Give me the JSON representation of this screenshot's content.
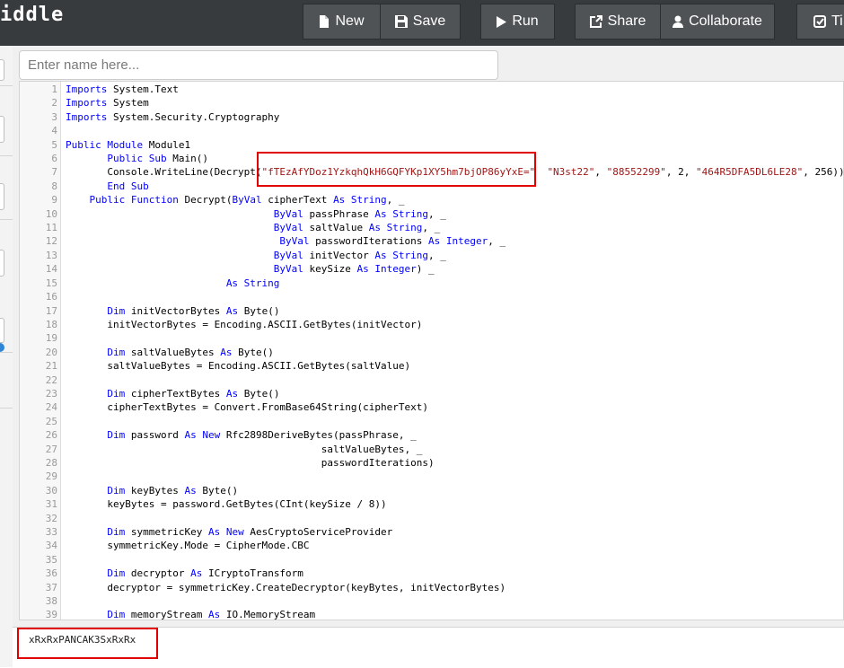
{
  "app": {
    "logo_text": "iddle"
  },
  "toolbar": [
    {
      "id": "new",
      "label": "New",
      "icon": "file-icon"
    },
    {
      "id": "save",
      "label": "Save",
      "icon": "floppy-icon"
    },
    {
      "id": "run",
      "label": "Run",
      "icon": "play-icon"
    },
    {
      "id": "share",
      "label": "Share",
      "icon": "share-icon"
    },
    {
      "id": "collaborate",
      "label": "Collaborate",
      "icon": "user-icon"
    },
    {
      "id": "tidy",
      "label": "Ti",
      "icon": "checkbox-icon"
    }
  ],
  "name_field": {
    "placeholder": "Enter name here...",
    "value": ""
  },
  "editor": {
    "lines": [
      [
        [
          "kw",
          "Imports"
        ],
        [
          "t",
          " System.Text"
        ]
      ],
      [
        [
          "kw",
          "Imports"
        ],
        [
          "t",
          " System"
        ]
      ],
      [
        [
          "kw",
          "Imports"
        ],
        [
          "t",
          " System.Security.Cryptography"
        ]
      ],
      [],
      [
        [
          "kw",
          "Public Module"
        ],
        [
          "t",
          " Module1"
        ]
      ],
      [
        [
          "t",
          "       "
        ],
        [
          "kw",
          "Public Sub"
        ],
        [
          "t",
          " Main()"
        ]
      ],
      [
        [
          "t",
          "       Console.WriteLine(Decrypt("
        ],
        [
          "st",
          "\"fTEzAfYDoz1YzkqhQkH6GQFYKp1XY5hm7bjOP86yYxE=\""
        ],
        [
          "t",
          "  "
        ],
        [
          "st",
          "\"N3st22\""
        ],
        [
          "t",
          ", "
        ],
        [
          "st",
          "\"88552299\""
        ],
        [
          "t",
          ", 2, "
        ],
        [
          "st",
          "\"464R5DFA5DL6LE28\""
        ],
        [
          "t",
          ", 256))"
        ]
      ],
      [
        [
          "t",
          "       "
        ],
        [
          "kw",
          "End Sub"
        ]
      ],
      [
        [
          "t",
          "    "
        ],
        [
          "kw",
          "Public Function"
        ],
        [
          "t",
          " Decrypt("
        ],
        [
          "kw",
          "ByVal"
        ],
        [
          "t",
          " cipherText "
        ],
        [
          "kw",
          "As String"
        ],
        [
          "t",
          ", _"
        ]
      ],
      [
        [
          "t",
          "                                   "
        ],
        [
          "kw",
          "ByVal"
        ],
        [
          "t",
          " passPhrase "
        ],
        [
          "kw",
          "As String"
        ],
        [
          "t",
          ", _"
        ]
      ],
      [
        [
          "t",
          "                                   "
        ],
        [
          "kw",
          "ByVal"
        ],
        [
          "t",
          " saltValue "
        ],
        [
          "kw",
          "As String"
        ],
        [
          "t",
          ", _"
        ]
      ],
      [
        [
          "t",
          "                                    "
        ],
        [
          "kw",
          "ByVal"
        ],
        [
          "t",
          " passwordIterations "
        ],
        [
          "kw",
          "As Integer"
        ],
        [
          "t",
          ", _"
        ]
      ],
      [
        [
          "t",
          "                                   "
        ],
        [
          "kw",
          "ByVal"
        ],
        [
          "t",
          " initVector "
        ],
        [
          "kw",
          "As String"
        ],
        [
          "t",
          ", _"
        ]
      ],
      [
        [
          "t",
          "                                   "
        ],
        [
          "kw",
          "ByVal"
        ],
        [
          "t",
          " keySize "
        ],
        [
          "kw",
          "As Integer"
        ],
        [
          "t",
          ") _"
        ]
      ],
      [
        [
          "t",
          "                           "
        ],
        [
          "kw",
          "As String"
        ]
      ],
      [],
      [
        [
          "t",
          "       "
        ],
        [
          "kw",
          "Dim"
        ],
        [
          "t",
          " initVectorBytes "
        ],
        [
          "kw",
          "As"
        ],
        [
          "t",
          " Byte()"
        ]
      ],
      [
        [
          "t",
          "       initVectorBytes = Encoding.ASCII.GetBytes(initVector)"
        ]
      ],
      [],
      [
        [
          "t",
          "       "
        ],
        [
          "kw",
          "Dim"
        ],
        [
          "t",
          " saltValueBytes "
        ],
        [
          "kw",
          "As"
        ],
        [
          "t",
          " Byte()"
        ]
      ],
      [
        [
          "t",
          "       saltValueBytes = Encoding.ASCII.GetBytes(saltValue)"
        ]
      ],
      [],
      [
        [
          "t",
          "       "
        ],
        [
          "kw",
          "Dim"
        ],
        [
          "t",
          " cipherTextBytes "
        ],
        [
          "kw",
          "As"
        ],
        [
          "t",
          " Byte()"
        ]
      ],
      [
        [
          "t",
          "       cipherTextBytes = Convert.FromBase64String(cipherText)"
        ]
      ],
      [],
      [
        [
          "t",
          "       "
        ],
        [
          "kw",
          "Dim"
        ],
        [
          "t",
          " password "
        ],
        [
          "kw",
          "As New"
        ],
        [
          "t",
          " Rfc2898DeriveBytes(passPhrase, _"
        ]
      ],
      [
        [
          "t",
          "                                           saltValueBytes, _"
        ]
      ],
      [
        [
          "t",
          "                                           passwordIterations)"
        ]
      ],
      [],
      [
        [
          "t",
          "       "
        ],
        [
          "kw",
          "Dim"
        ],
        [
          "t",
          " keyBytes "
        ],
        [
          "kw",
          "As"
        ],
        [
          "t",
          " Byte()"
        ]
      ],
      [
        [
          "t",
          "       keyBytes = password.GetBytes(CInt(keySize / 8))"
        ]
      ],
      [],
      [
        [
          "t",
          "       "
        ],
        [
          "kw",
          "Dim"
        ],
        [
          "t",
          " symmetricKey "
        ],
        [
          "kw",
          "As New"
        ],
        [
          "t",
          " AesCryptoServiceProvider"
        ]
      ],
      [
        [
          "t",
          "       symmetricKey.Mode = CipherMode.CBC"
        ]
      ],
      [],
      [
        [
          "t",
          "       "
        ],
        [
          "kw",
          "Dim"
        ],
        [
          "t",
          " decryptor "
        ],
        [
          "kw",
          "As"
        ],
        [
          "t",
          " ICryptoTransform"
        ]
      ],
      [
        [
          "t",
          "       decryptor = symmetricKey.CreateDecryptor(keyBytes, initVectorBytes)"
        ]
      ],
      [],
      [
        [
          "t",
          "       "
        ],
        [
          "kw",
          "Dim"
        ],
        [
          "t",
          " memoryStream "
        ],
        [
          "kw",
          "As"
        ],
        [
          "t",
          " IO.MemoryStream"
        ]
      ]
    ]
  },
  "output": {
    "text": "xRxRxPANCAK3SxRxRx"
  },
  "colors": {
    "toolbar_bg": "#383b3e",
    "button_bg": "#4f5356",
    "keyword": "#0000ff",
    "string": "#a31515",
    "highlight_box": "#e00000"
  }
}
